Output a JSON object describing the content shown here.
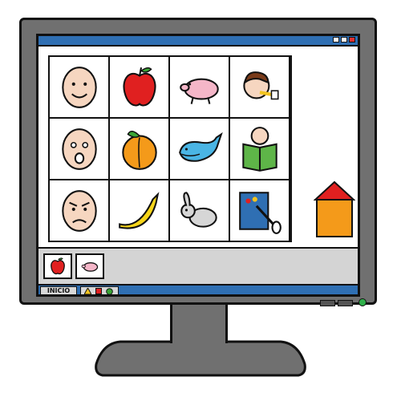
{
  "taskbar": {
    "start_label": "INICIO"
  },
  "grid": {
    "items": [
      {
        "name": "happy-face-icon"
      },
      {
        "name": "apple-icon"
      },
      {
        "name": "pig-icon"
      },
      {
        "name": "person-eating-icon"
      },
      {
        "name": "scared-face-icon"
      },
      {
        "name": "peach-icon"
      },
      {
        "name": "whale-icon"
      },
      {
        "name": "child-reading-icon"
      },
      {
        "name": "angry-face-icon"
      },
      {
        "name": "banana-icon"
      },
      {
        "name": "rabbit-icon"
      },
      {
        "name": "painting-icon"
      }
    ]
  },
  "tray": {
    "items": [
      {
        "name": "apple-icon"
      },
      {
        "name": "pig-icon"
      }
    ]
  },
  "colors": {
    "titlebar": "#2f6fb3",
    "frame": "#707070",
    "tray": "#d4d4d4",
    "power_led": "#2fb04a"
  }
}
